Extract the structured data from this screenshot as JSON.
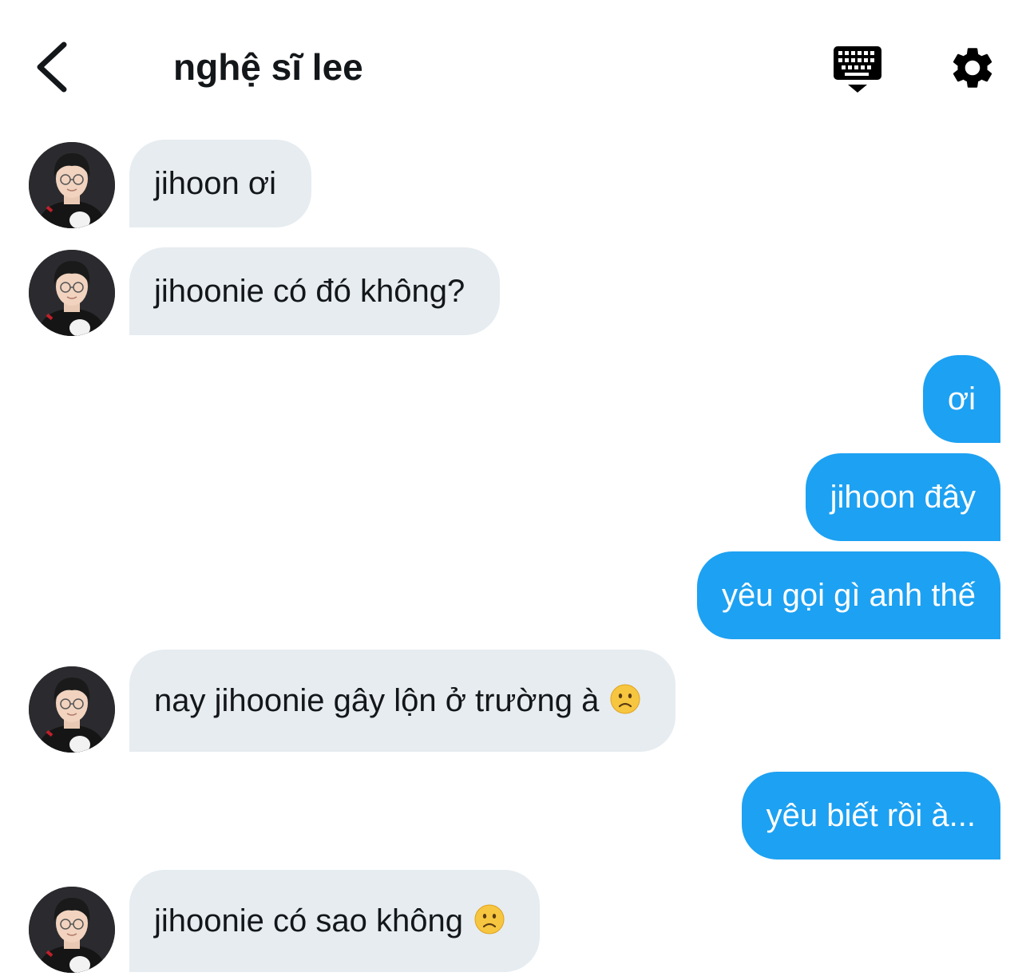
{
  "header": {
    "back_icon": "chevron-left-icon",
    "title": "nghệ sĩ lee",
    "keyboard_icon": "keyboard-hide-icon",
    "settings_icon": "gear-icon"
  },
  "messages": [
    {
      "side": "in",
      "text": "jihoon ơi"
    },
    {
      "side": "in",
      "text": "jihoonie có đó không?"
    },
    {
      "side": "out",
      "text": "ơi"
    },
    {
      "side": "out",
      "text": "jihoon đây"
    },
    {
      "side": "out",
      "text": "yêu gọi gì anh thế"
    },
    {
      "side": "in",
      "text": "nay jihoonie gây lộn ở trường à",
      "emoji": "slightly-frowning-face"
    },
    {
      "side": "out",
      "text": "yêu biết rồi à..."
    },
    {
      "side": "in",
      "text": "jihoonie có sao không",
      "emoji": "slightly-frowning-face"
    }
  ],
  "colors": {
    "incoming_bubble": "#e6ecf0",
    "outgoing_bubble": "#1da1f2",
    "text": "#14171a"
  }
}
